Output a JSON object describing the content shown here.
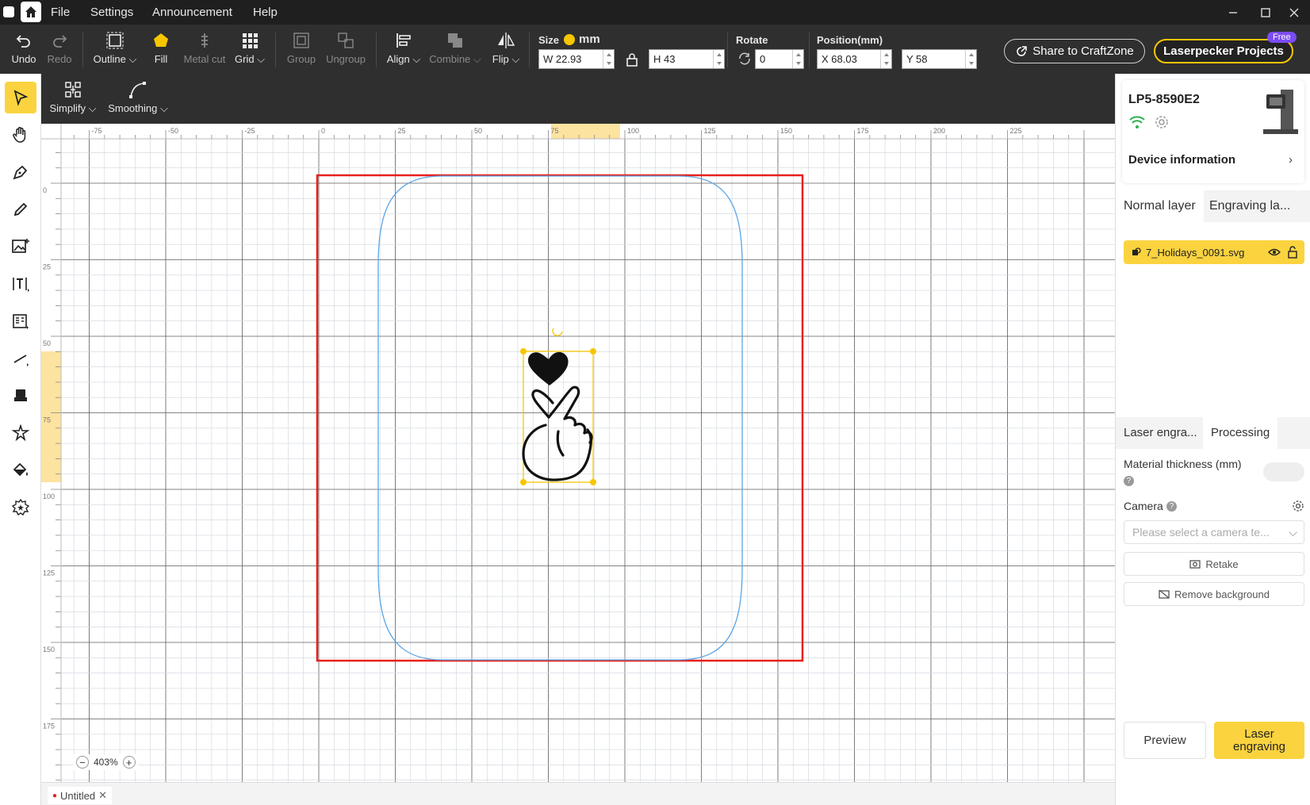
{
  "menubar": {
    "items": [
      "File",
      "Settings",
      "Announcement",
      "Help"
    ]
  },
  "toolbar": {
    "undo": "Undo",
    "redo": "Redo",
    "outline": "Outline",
    "fill": "Fill",
    "metal_cut": "Metal cut",
    "grid": "Grid",
    "group": "Group",
    "ungroup": "Ungroup",
    "align": "Align",
    "combine": "Combine",
    "flip": "Flip",
    "size_label": "Size",
    "unit": "mm",
    "width": "W 22.93",
    "height": "H 43",
    "rotate_label": "Rotate",
    "rotate": "0",
    "position_label": "Position(mm)",
    "pos_x": "X 68.03",
    "pos_y": "Y 58",
    "share": "Share to CraftZone",
    "projects": "Laserpecker Projects",
    "free": "Free"
  },
  "subtoolbar": {
    "simplify": "Simplify",
    "smoothing": "Smoothing"
  },
  "ruler": {
    "top_ticks": [
      "-75",
      "-50",
      "-25",
      "0",
      "25",
      "50",
      "75",
      "100",
      "125",
      "150",
      "175",
      "200",
      "225"
    ],
    "left_ticks": [
      "0",
      "25",
      "50",
      "75",
      "100",
      "125",
      "150",
      "175"
    ]
  },
  "canvas": {
    "zoom": "403%"
  },
  "doc_tab": {
    "name": "Untitled"
  },
  "device": {
    "name": "LP5-8590E2",
    "info": "Device information"
  },
  "layers": {
    "tabs": [
      "Normal layer",
      "Engraving la..."
    ],
    "item": "7_Holidays_0091.svg"
  },
  "processing": {
    "tabs": [
      "Laser engra...",
      "Processing"
    ],
    "material_thickness": "Material thickness (mm)",
    "camera": "Camera",
    "camera_placeholder": "Please select a camera te...",
    "retake": "Retake",
    "remove_bg": "Remove background",
    "preview": "Preview",
    "engrave": "Laser engraving"
  },
  "colors": {
    "accent": "#fbd33f",
    "work_area": "#e8201c",
    "outline": "#5aa5e6"
  }
}
